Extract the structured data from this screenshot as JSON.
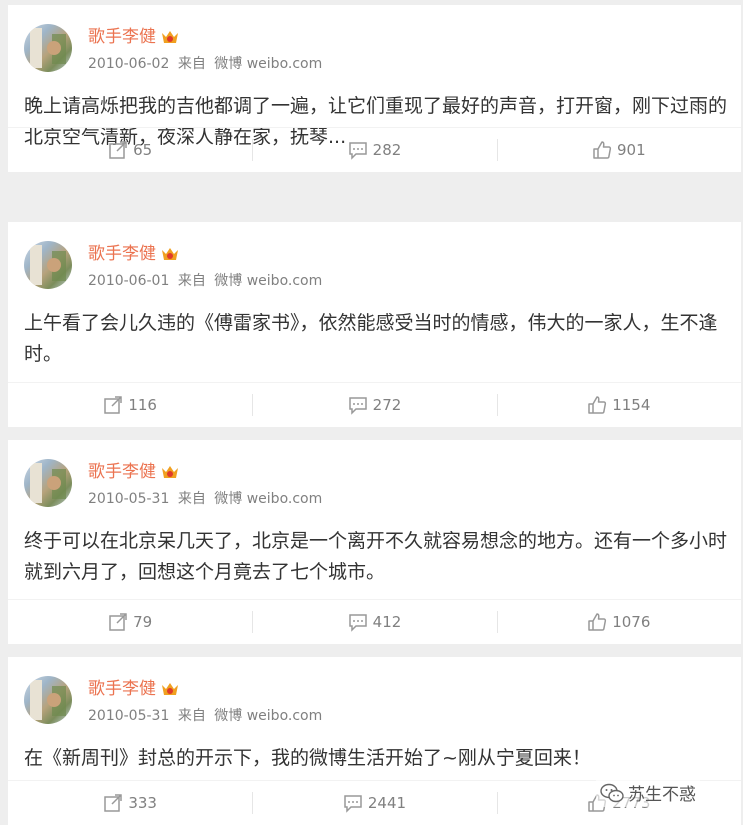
{
  "colors": {
    "name": "#eb7350",
    "text": "#333333",
    "meta": "#808080",
    "bg": "#eeeeee"
  },
  "posts": [
    {
      "author": "歌手李健",
      "date": "2010-06-02",
      "via": "来自",
      "source": "微博 weibo.com",
      "text": "晚上请高烁把我的吉他都调了一遍，让它们重现了最好的声音，打开窗，刚下过雨的北京空气清新，夜深人静在家，抚琴...",
      "reposts": "65",
      "comments": "282",
      "likes": "901"
    },
    {
      "author": "歌手李健",
      "date": "2010-06-01",
      "via": "来自",
      "source": "微博 weibo.com",
      "text": "上午看了会儿久违的《傅雷家书》，依然能感受当时的情感，伟大的一家人，生不逢时。",
      "reposts": "116",
      "comments": "272",
      "likes": "1154"
    },
    {
      "author": "歌手李健",
      "date": "2010-05-31",
      "via": "来自",
      "source": "微博 weibo.com",
      "text": "终于可以在北京呆几天了，北京是一个离开不久就容易想念的地方。还有一个多小时就到六月了，回想这个月竟去了七个城市。",
      "reposts": "79",
      "comments": "412",
      "likes": "1076"
    },
    {
      "author": "歌手李健",
      "date": "2010-05-31",
      "via": "来自",
      "source": "微博 weibo.com",
      "text": "在《新周刊》封总的开示下，我的微博生活开始了~刚从宁夏回来！",
      "reposts": "333",
      "comments": "2441",
      "likes": "2773"
    }
  ],
  "watermark": {
    "text": "苏生不惑",
    "icon": "wechat-icon"
  }
}
